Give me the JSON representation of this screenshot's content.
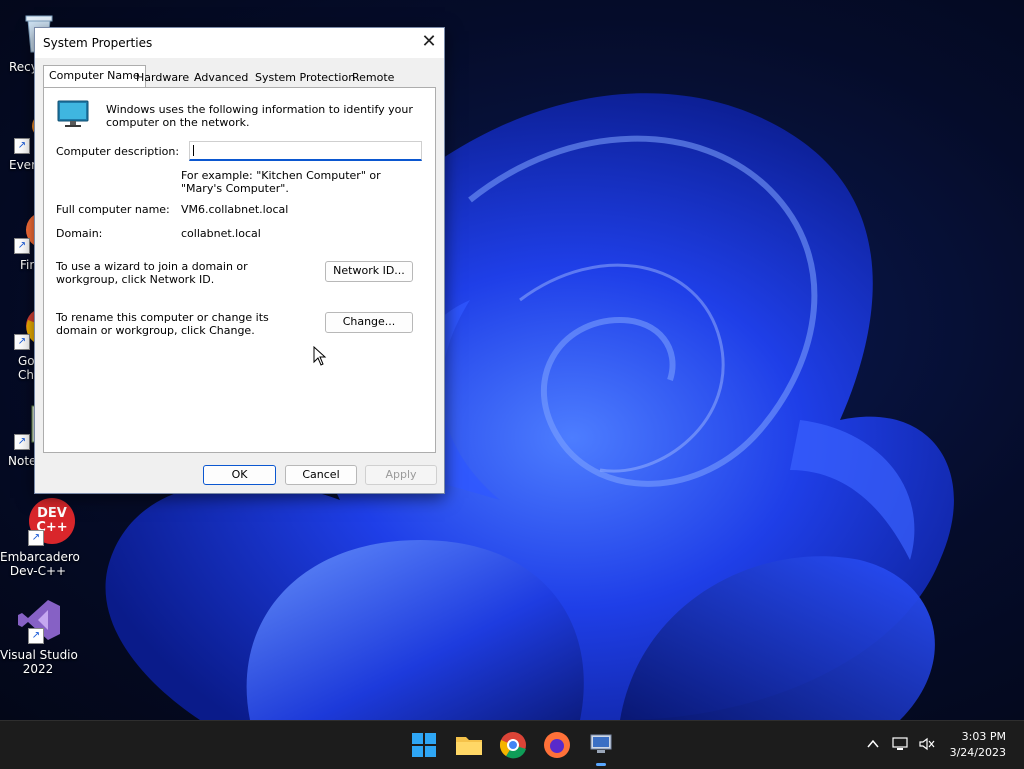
{
  "desktop": {
    "icons": [
      {
        "label": "Recy",
        "icon": "recycle-bin-icon"
      },
      {
        "label": "Ever",
        "icon": "everything-icon"
      },
      {
        "label": "Fir",
        "icon": "firefox-icon"
      },
      {
        "label": "Go\nChr",
        "icon": "chrome-icon"
      },
      {
        "label": "Note",
        "icon": "notepad-icon"
      },
      {
        "label": "Embarcadero\nDev-C++",
        "icon": "devcpp-icon"
      },
      {
        "label": "Visual Studio\n2022",
        "icon": "visual-studio-icon"
      }
    ],
    "devcpp_logo_text": "DEV\nC++"
  },
  "dialog": {
    "title": "System Properties",
    "close_glyph": "✕",
    "tabs": [
      {
        "label": "Computer Name",
        "active": true
      },
      {
        "label": "Hardware",
        "active": false
      },
      {
        "label": "Advanced",
        "active": false
      },
      {
        "label": "System Protection",
        "active": false
      },
      {
        "label": "Remote",
        "active": false
      }
    ],
    "intro": "Windows uses the following information to identify your computer on the network.",
    "description_label": "Computer description:",
    "description_value": "",
    "example_text": "For example: \"Kitchen Computer\" or \"Mary's Computer\".",
    "full_name_label": "Full computer name:",
    "full_name_value": "VM6.collabnet.local",
    "domain_label": "Domain:",
    "domain_value": "collabnet.local",
    "wizard_text": "To use a wizard to join a domain or workgroup, click Network ID.",
    "network_id_button": "Network ID...",
    "rename_text": "To rename this computer or change its domain or workgroup, click Change.",
    "change_button": "Change...",
    "ok_button": "OK",
    "cancel_button": "Cancel",
    "apply_button": "Apply"
  },
  "taskbar": {
    "items": [
      "start-icon",
      "file-explorer-icon",
      "chrome-icon",
      "firefox-icon",
      "remote-desktop-icon"
    ],
    "tray": [
      "chevron-up-icon",
      "network-icon",
      "volume-muted-icon"
    ],
    "time": "3:03 PM",
    "date": "3/24/2023"
  },
  "colors": {
    "accent": "#0b57d0",
    "wallpaper_blue": "#1a3cff",
    "taskbar": "#1c1c1c"
  }
}
